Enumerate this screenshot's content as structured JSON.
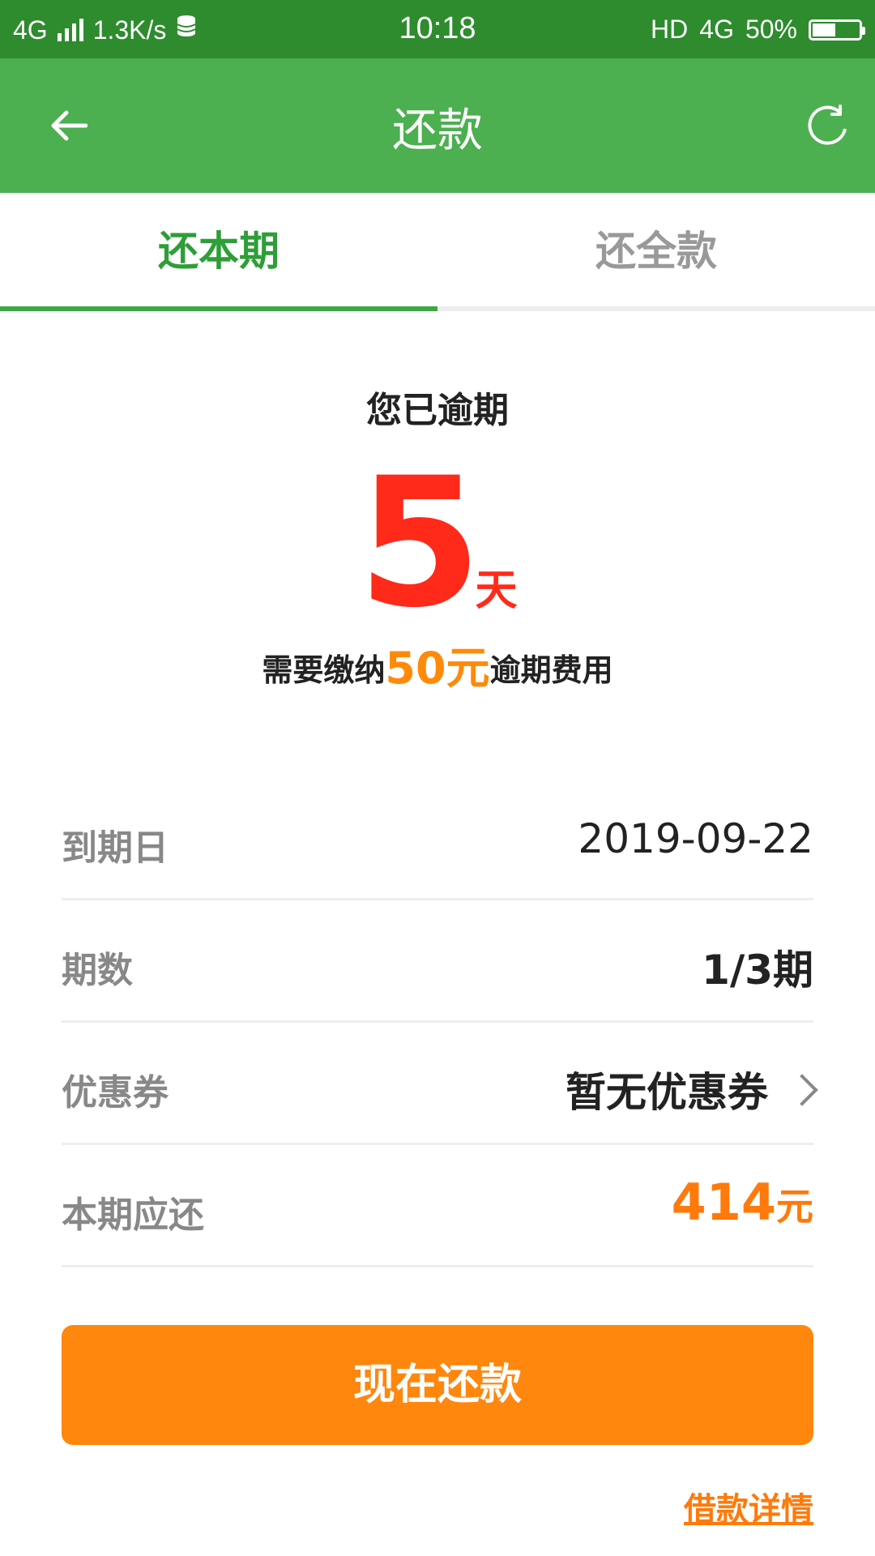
{
  "status_bar": {
    "network": "4G",
    "speed": "1.3K/s",
    "time": "10:18",
    "hd": "HD",
    "network_right": "4G",
    "battery_percent": "50%",
    "battery_level": 0.5
  },
  "header": {
    "title": "还款"
  },
  "tabs": [
    {
      "label": "还本期",
      "active": true
    },
    {
      "label": "还全款",
      "active": false
    }
  ],
  "overdue": {
    "title": "您已逾期",
    "days": "5",
    "unit": "天",
    "fee_prefix": "需要缴纳",
    "fee_amount": "50元",
    "fee_suffix": "逾期费用"
  },
  "info": {
    "rows": [
      {
        "label": "到期日",
        "value": "2019-09-22"
      },
      {
        "label": "期数",
        "value": "1/3期"
      },
      {
        "label": "优惠券",
        "value": "暂无优惠券"
      },
      {
        "label": "本期应还",
        "value": "414",
        "unit": "元"
      }
    ]
  },
  "actions": {
    "pay_now": "现在还款",
    "loan_details": "借款详情"
  },
  "colors": {
    "primary_green": "#4caf50",
    "status_green": "#2e8b2e",
    "orange": "#ff870d",
    "red": "#ff2a1a"
  }
}
